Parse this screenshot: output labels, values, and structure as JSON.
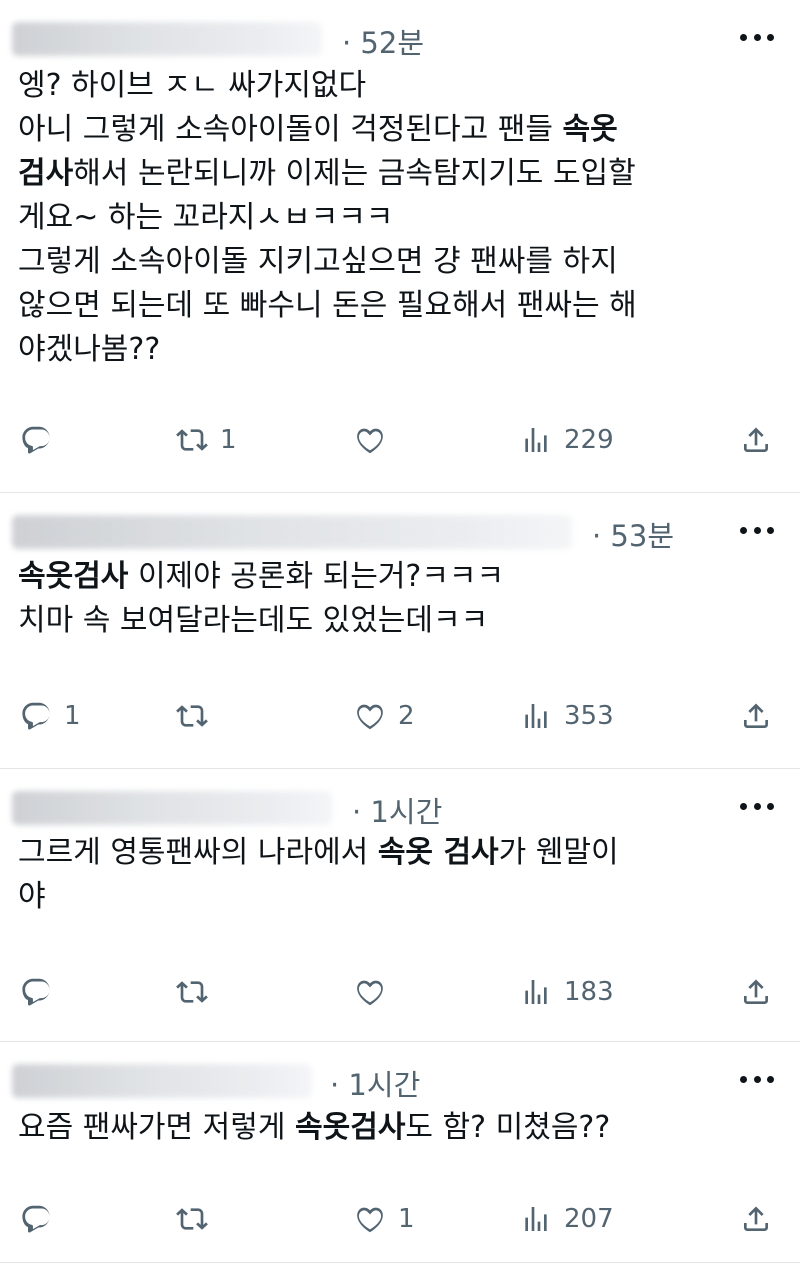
{
  "posts": [
    {
      "time": "· 52분",
      "lines": [
        [
          {
            "t": "엥? 하이브 ㅈㄴ 싸가지없다",
            "b": false
          }
        ],
        [
          {
            "t": "아니 그렇게 소속아이돌이 걱정된다고 팬들 ",
            "b": false
          },
          {
            "t": "속옷",
            "b": true
          }
        ],
        [
          {
            "t": "검사",
            "b": true
          },
          {
            "t": "해서 논란되니까 이제는 금속탐지기도 도입할",
            "b": false
          }
        ],
        [
          {
            "t": "게요~ 하는 꼬라지ㅅㅂㅋㅋㅋ",
            "b": false
          }
        ],
        [
          {
            "t": "그렇게 소속아이돌 지키고싶으면 걍 팬싸를 하지",
            "b": false
          }
        ],
        [
          {
            "t": "않으면 되는데 또 빠수니 돈은 필요해서 팬싸는 해",
            "b": false
          }
        ],
        [
          {
            "t": "야겠나봄??",
            "b": false
          }
        ]
      ],
      "reply_count": "",
      "retweet_count": "1",
      "like_count": "",
      "view_count": "229"
    },
    {
      "time": "· 53분",
      "lines": [
        [
          {
            "t": "속옷검사",
            "b": true
          },
          {
            "t": " 이제야 공론화 되는거?ㅋㅋㅋ",
            "b": false
          }
        ],
        [
          {
            "t": "치마 속 보여달라는데도 있었는데ㅋㅋ",
            "b": false
          }
        ]
      ],
      "reply_count": "1",
      "retweet_count": "",
      "like_count": "2",
      "view_count": "353"
    },
    {
      "time": "· 1시간",
      "lines": [
        [
          {
            "t": "그르게 영통팬싸의 나라에서 ",
            "b": false
          },
          {
            "t": "속옷 검사",
            "b": true
          },
          {
            "t": "가 웬말이",
            "b": false
          }
        ],
        [
          {
            "t": "야",
            "b": false
          }
        ]
      ],
      "reply_count": "",
      "retweet_count": "",
      "like_count": "",
      "view_count": "183"
    },
    {
      "time": "· 1시간",
      "lines": [
        [
          {
            "t": "요즘 팬싸가면 저렇게 ",
            "b": false
          },
          {
            "t": "속옷검사",
            "b": true
          },
          {
            "t": "도 함? 미쳤음??",
            "b": false
          }
        ]
      ],
      "reply_count": "",
      "retweet_count": "",
      "like_count": "1",
      "view_count": "207"
    }
  ],
  "icons": {
    "reply": "reply-icon",
    "retweet": "retweet-icon",
    "like": "heart-icon",
    "views": "views-icon",
    "share": "share-icon",
    "more": "more-icon"
  },
  "colors": {
    "text": "#0f1419",
    "muted": "#536471",
    "divider": "#e3e6e8"
  }
}
